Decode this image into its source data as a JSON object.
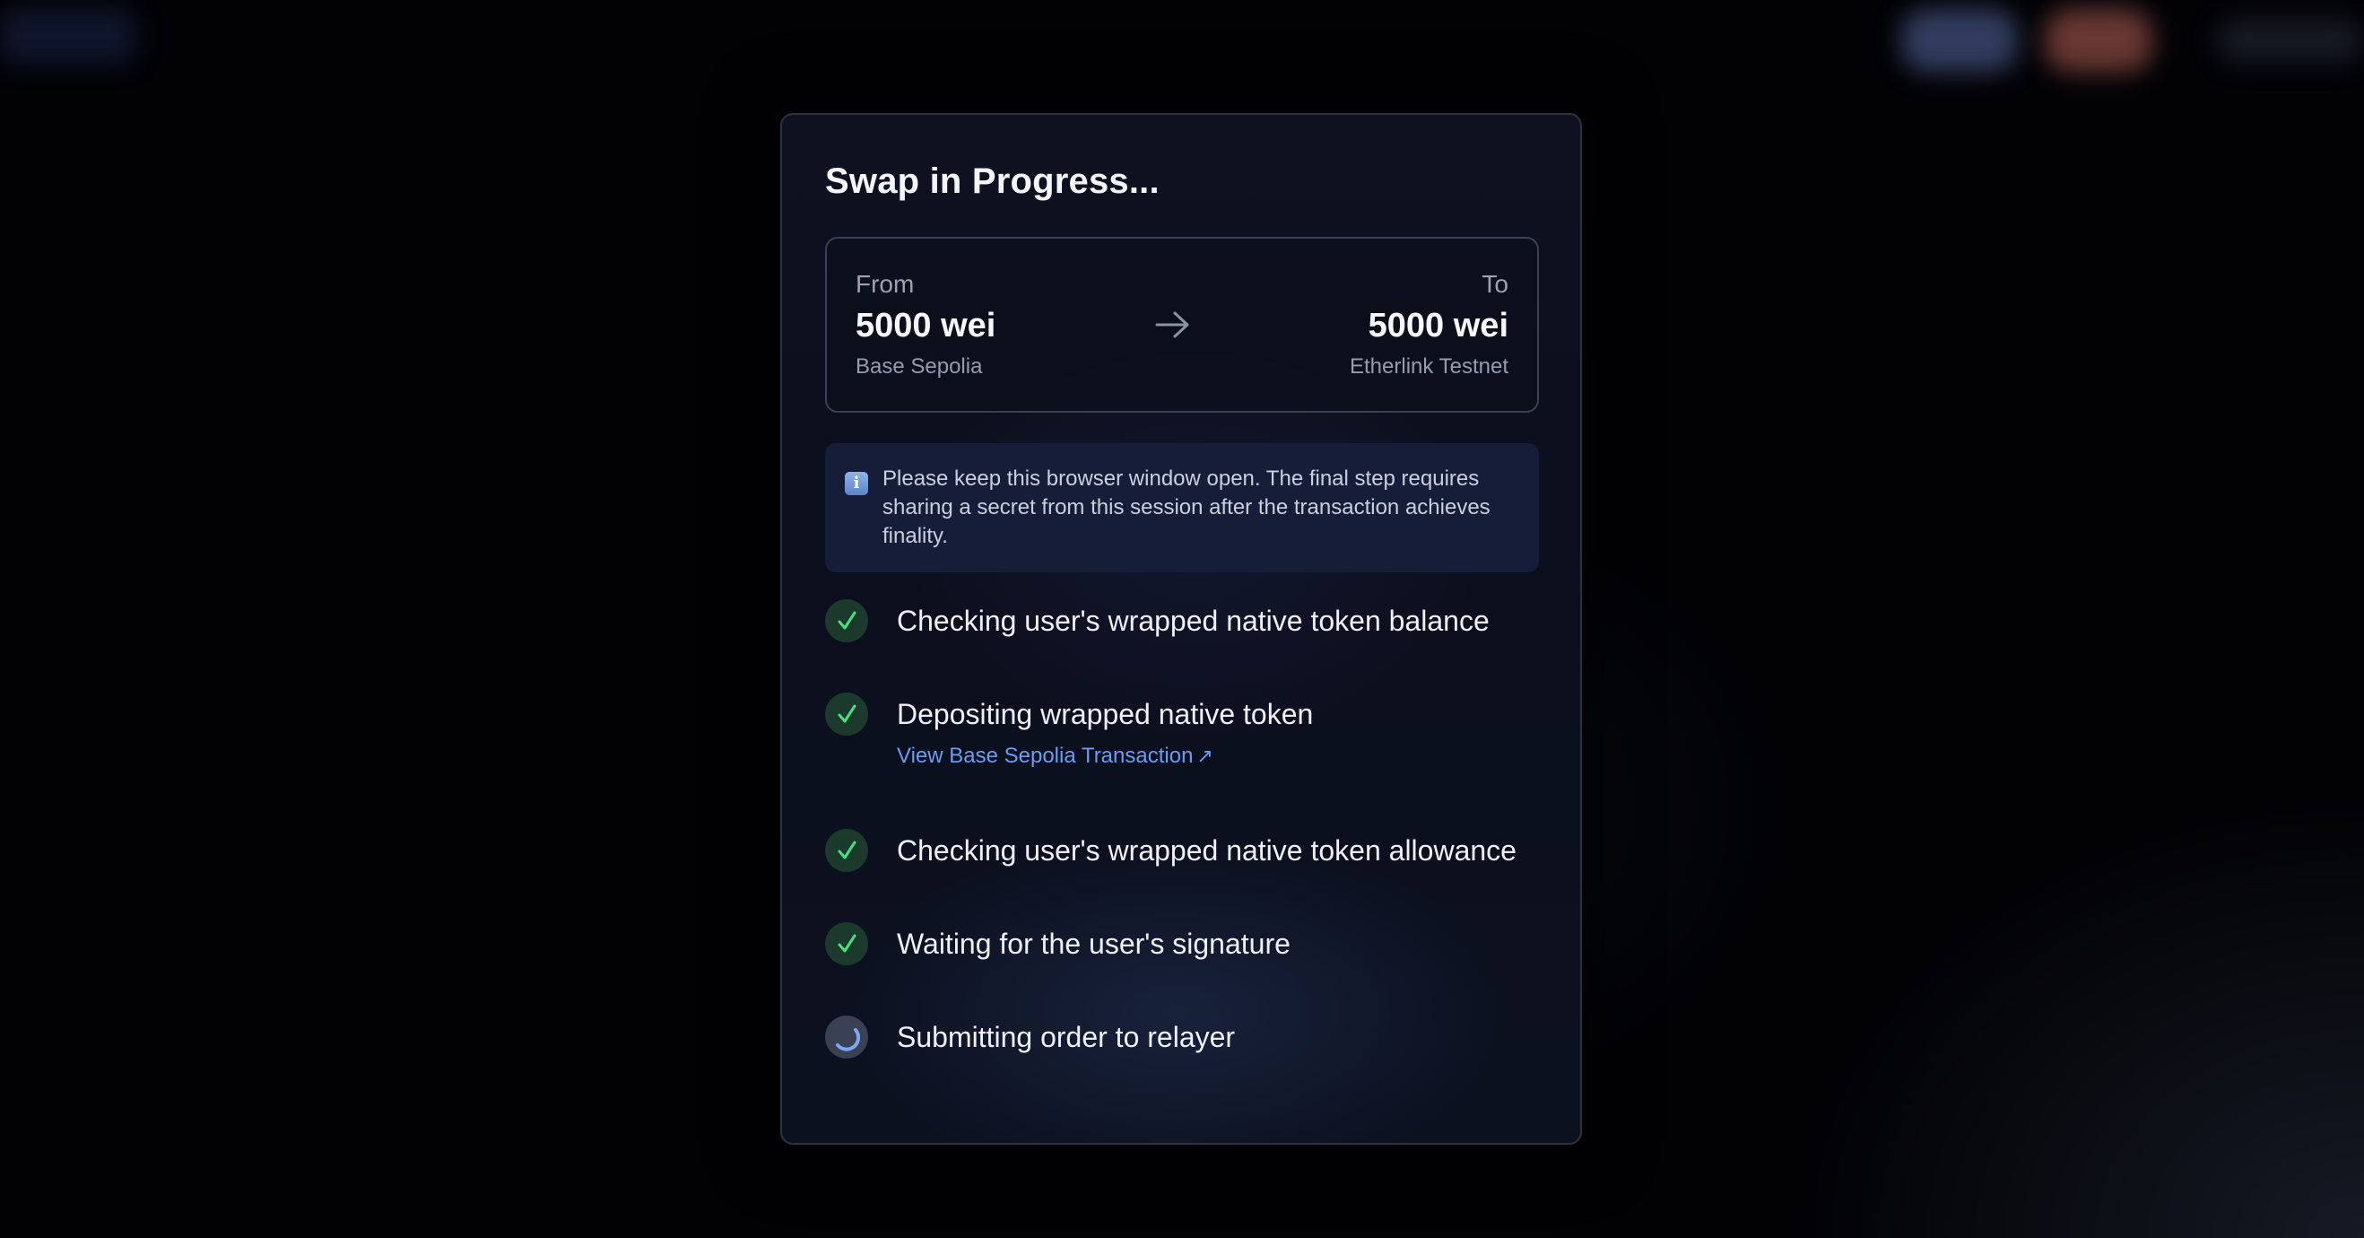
{
  "modal": {
    "title": "Swap in Progress..."
  },
  "swap": {
    "from": {
      "label": "From",
      "amount": "5000 wei",
      "network": "Base Sepolia"
    },
    "to": {
      "label": "To",
      "amount": "5000 wei",
      "network": "Etherlink Testnet"
    },
    "arrow_icon": "arrow-right-icon"
  },
  "info": {
    "icon": "info-icon",
    "icon_glyph": "i",
    "text": "Please keep this browser window open. The final step requires sharing a secret from this session after the transaction achieves finality."
  },
  "steps": [
    {
      "label": "Checking user's wrapped native token balance",
      "status": "completed"
    },
    {
      "label": "Depositing wrapped native token",
      "status": "completed",
      "link": "View Base Sepolia Transaction",
      "link_icon": "↗"
    },
    {
      "label": "Checking user's wrapped native token allowance",
      "status": "completed"
    },
    {
      "label": "Waiting for the user's signature",
      "status": "completed"
    },
    {
      "label": "Submitting order to relayer",
      "status": "in-progress"
    }
  ],
  "colors": {
    "check_green": "#4ade80",
    "check_bg": "#1c3a2c",
    "link_blue": "#6a9cf0",
    "spinner_blue": "#7fa6f0"
  }
}
